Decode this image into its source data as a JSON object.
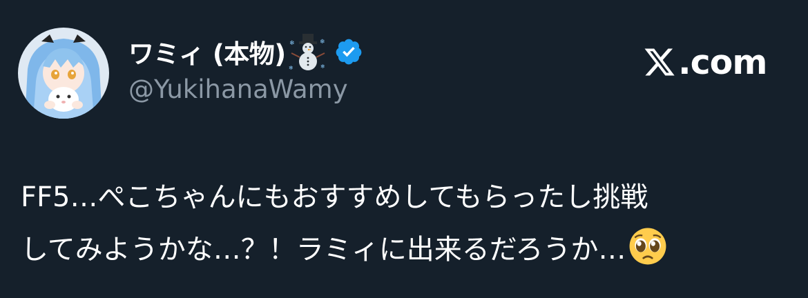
{
  "author": {
    "display_name": "ワミィ (本物)",
    "name_emoji": "snowman-with-snow-icon",
    "verified_icon": "verified-badge-icon",
    "handle": "@YukihanaWamy",
    "avatar": "avatar"
  },
  "brand": {
    "logo_icon": "x-logo-icon",
    "label": ".com"
  },
  "tweet": {
    "line1": "FF5…ぺこちゃんにもおすすめしてもらったし挑戦",
    "line2": "してみようかな…？！ラミィに出来るだろうか…",
    "trailing_emoji": "pleading-face-icon"
  },
  "colors": {
    "background": "#15202b",
    "text": "#ffffff",
    "handle": "#8b98a5",
    "verified": "#1d9bf0"
  }
}
